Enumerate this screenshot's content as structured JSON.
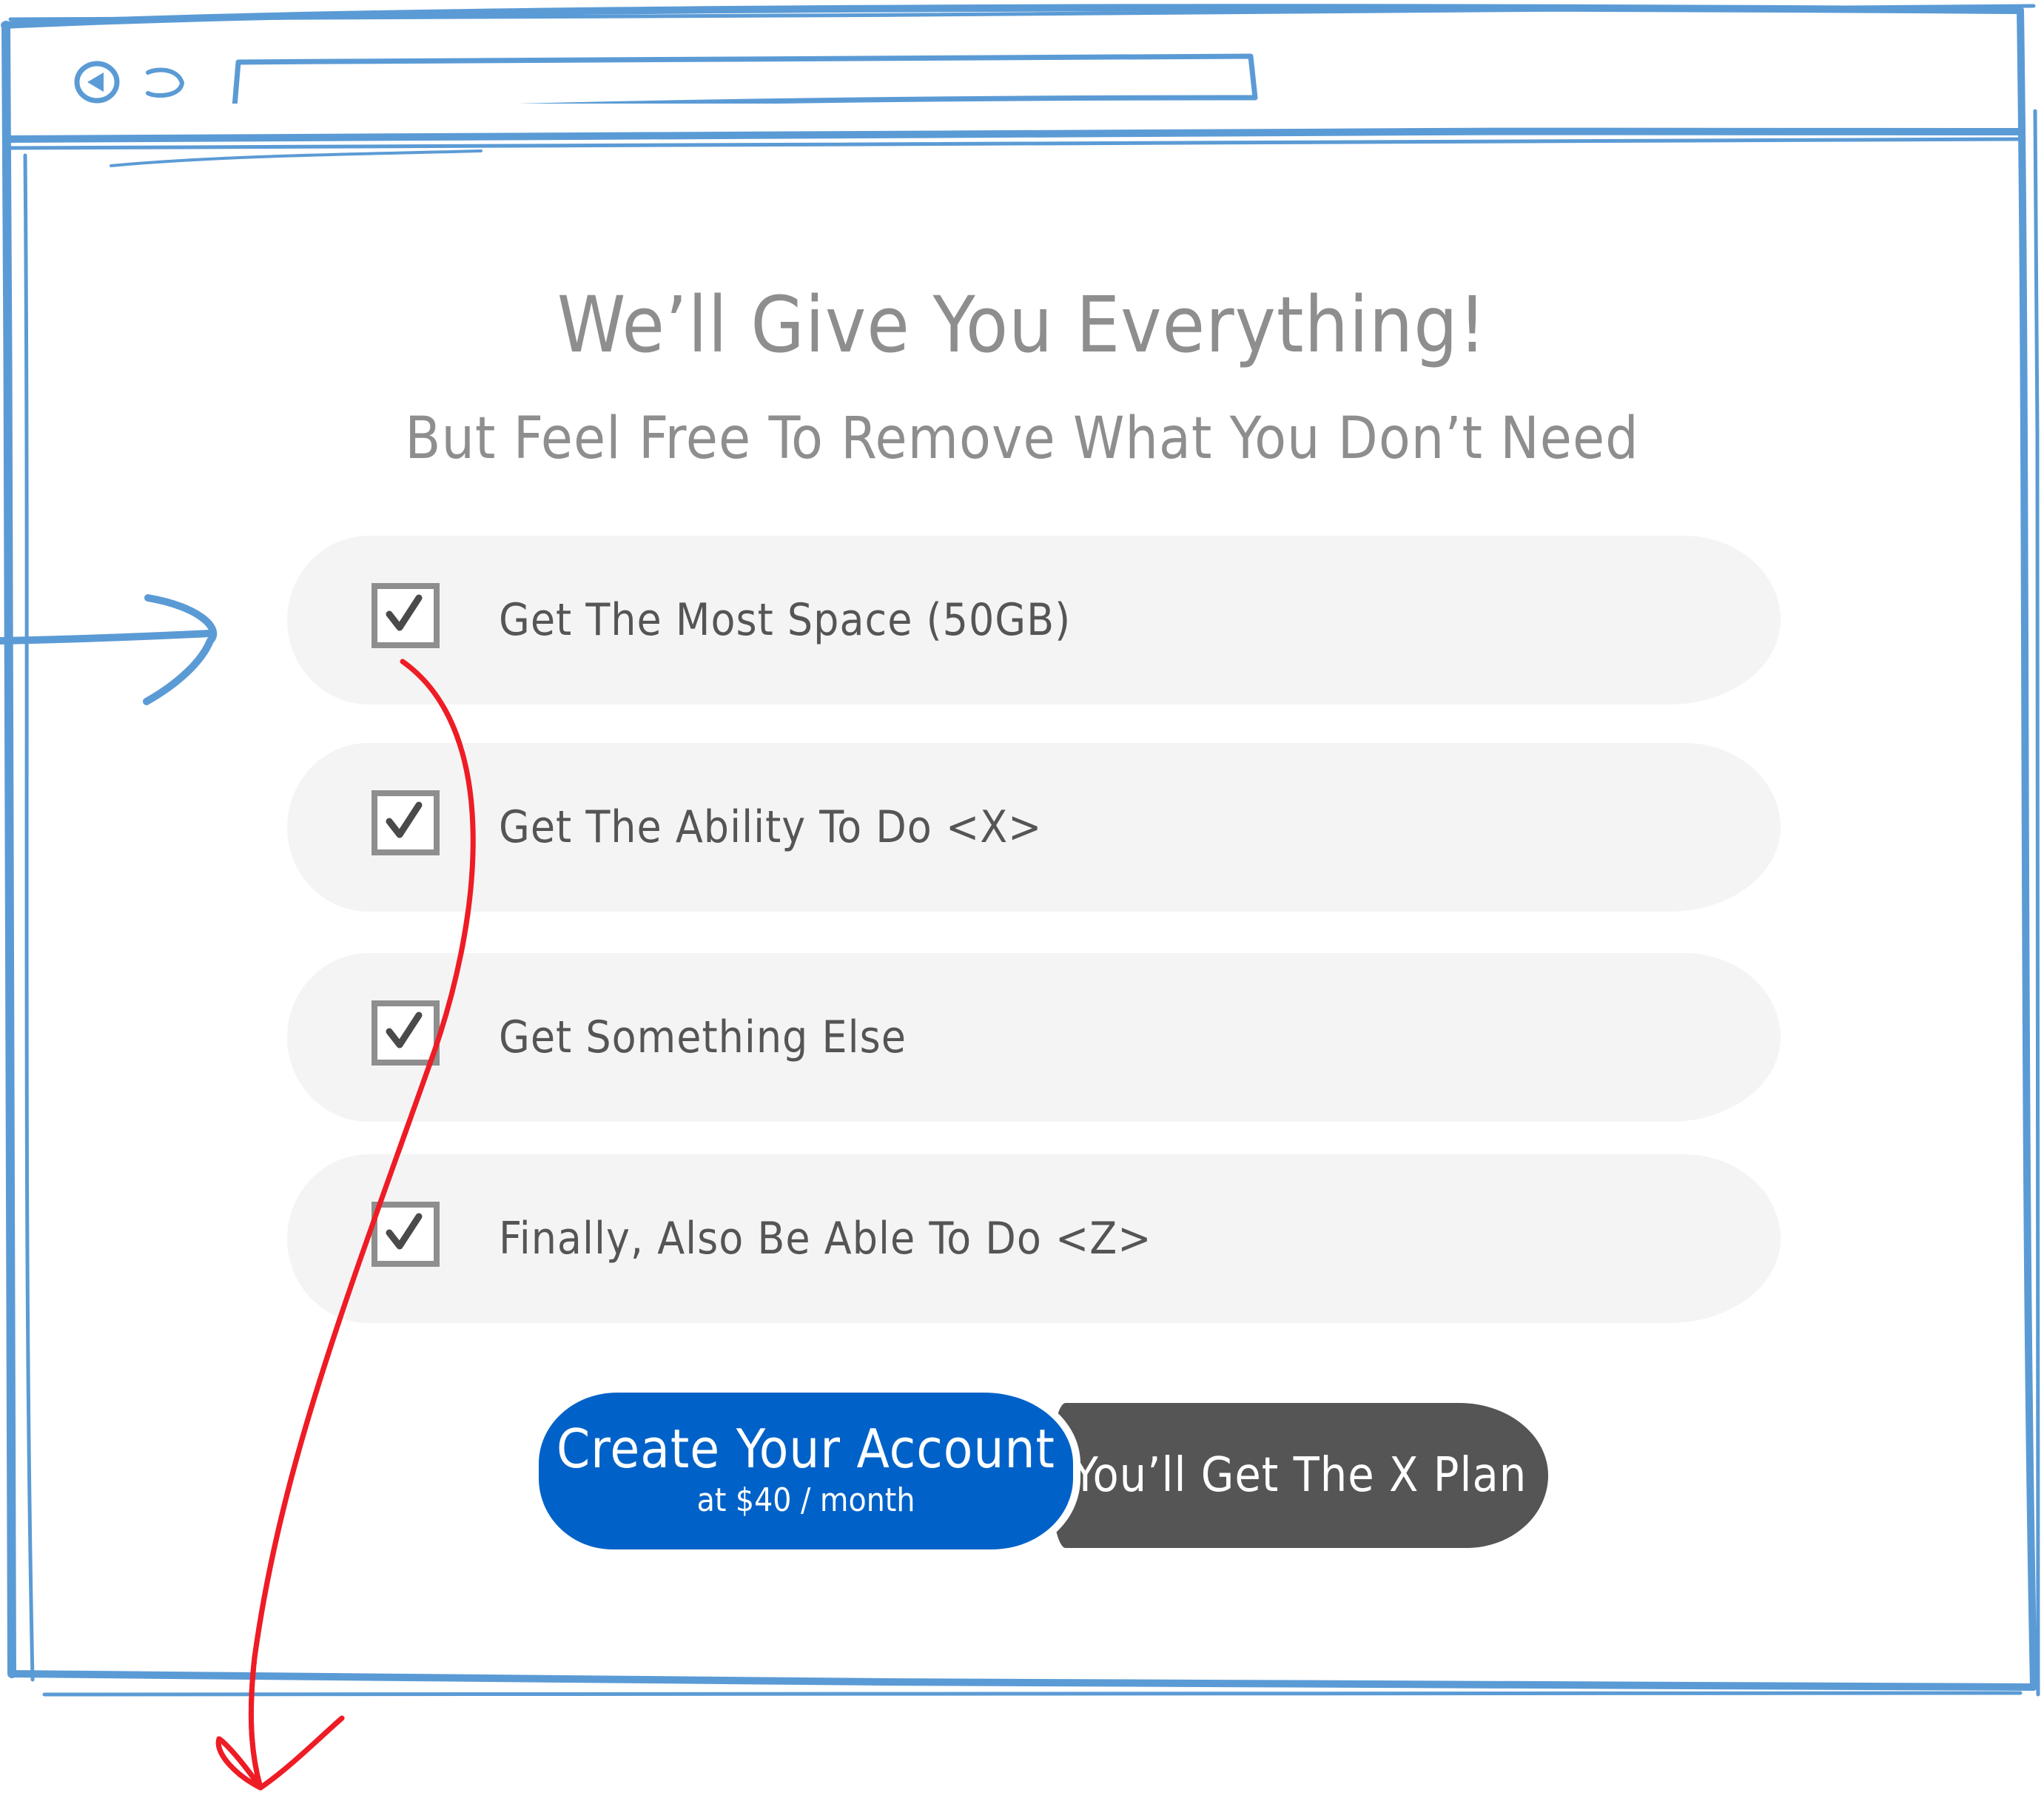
{
  "colors": {
    "frame": "#5b9bd5",
    "annotation_arrow": "#ee1c25",
    "cta_blue": "#0062c8",
    "plan_gray": "#555555",
    "row_background": "#f4f4f4",
    "text_gray": "#8e8e8e"
  },
  "browser": {
    "back_icon": "back-arrow-icon",
    "forward_icon": "forward-icon",
    "address_value": ""
  },
  "page": {
    "headline": "We’ll Give You Everything!",
    "subheadline": "But Feel Free To Remove What You Don’t Need"
  },
  "features": [
    {
      "label": "Get The Most Space (50GB)",
      "checked": true
    },
    {
      "label": "Get The Ability To Do <X>",
      "checked": true
    },
    {
      "label": "Get Something Else",
      "checked": true
    },
    {
      "label": "Finally, Also Be Able To Do <Z>",
      "checked": true
    }
  ],
  "cta": {
    "label": "Create Your Account",
    "price": "at $40 / month"
  },
  "plan": {
    "label": "You’ll Get The X Plan"
  }
}
